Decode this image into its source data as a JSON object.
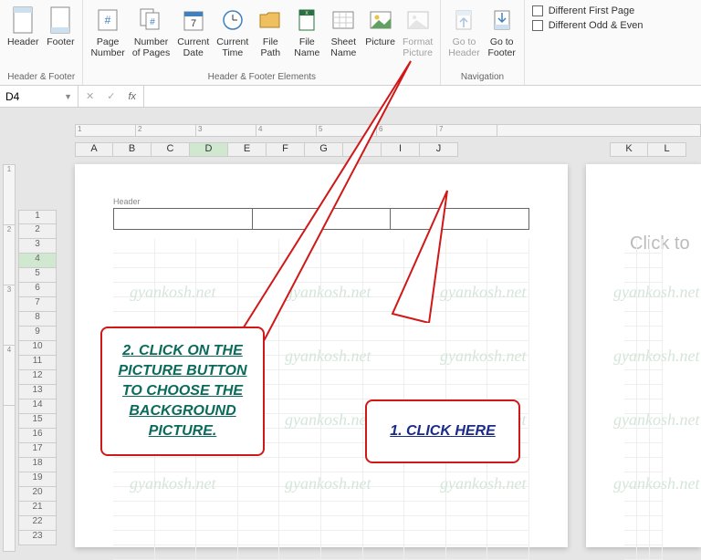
{
  "ribbon": {
    "groups": [
      {
        "label": "Header & Footer",
        "buttons": [
          {
            "label": "Header",
            "name": "header-button"
          },
          {
            "label": "Footer",
            "name": "footer-button"
          }
        ]
      },
      {
        "label": "Header & Footer Elements",
        "buttons": [
          {
            "label": "Page\nNumber",
            "name": "page-number-button"
          },
          {
            "label": "Number\nof Pages",
            "name": "number-of-pages-button"
          },
          {
            "label": "Current\nDate",
            "name": "current-date-button"
          },
          {
            "label": "Current\nTime",
            "name": "current-time-button"
          },
          {
            "label": "File\nPath",
            "name": "file-path-button"
          },
          {
            "label": "File\nName",
            "name": "file-name-button"
          },
          {
            "label": "Sheet\nName",
            "name": "sheet-name-button"
          },
          {
            "label": "Picture",
            "name": "picture-button"
          },
          {
            "label": "Format\nPicture",
            "name": "format-picture-button",
            "disabled": true
          }
        ]
      },
      {
        "label": "Navigation",
        "buttons": [
          {
            "label": "Go to\nHeader",
            "name": "goto-header-button",
            "disabled": true
          },
          {
            "label": "Go to\nFooter",
            "name": "goto-footer-button"
          }
        ]
      }
    ],
    "checks": [
      {
        "label": "Different First Page"
      },
      {
        "label": "Different Odd & Even"
      }
    ]
  },
  "name_box": "D4",
  "columns": [
    "A",
    "B",
    "C",
    "D",
    "E",
    "F",
    "G",
    "H",
    "I",
    "J"
  ],
  "columns2": [
    "K",
    "L"
  ],
  "rows": [
    "1",
    "2",
    "3",
    "4",
    "5",
    "6",
    "7",
    "8",
    "9",
    "10",
    "11",
    "12",
    "13",
    "14",
    "15",
    "16",
    "17",
    "18",
    "19",
    "20",
    "21",
    "22",
    "23"
  ],
  "ruler_v": [
    "1",
    "2",
    "3",
    "4"
  ],
  "ruler_h": [
    "1",
    "2",
    "3",
    "4",
    "5",
    "6",
    "7"
  ],
  "selected_col": "D",
  "selected_row": "4",
  "header_label": "Header",
  "page2_text": "Click to",
  "callout1": "2. CLICK ON THE PICTURE BUTTON TO CHOOSE THE BACKGROUND PICTURE.",
  "callout2": "1. CLICK HERE",
  "watermark_text": "gyankosh.net"
}
